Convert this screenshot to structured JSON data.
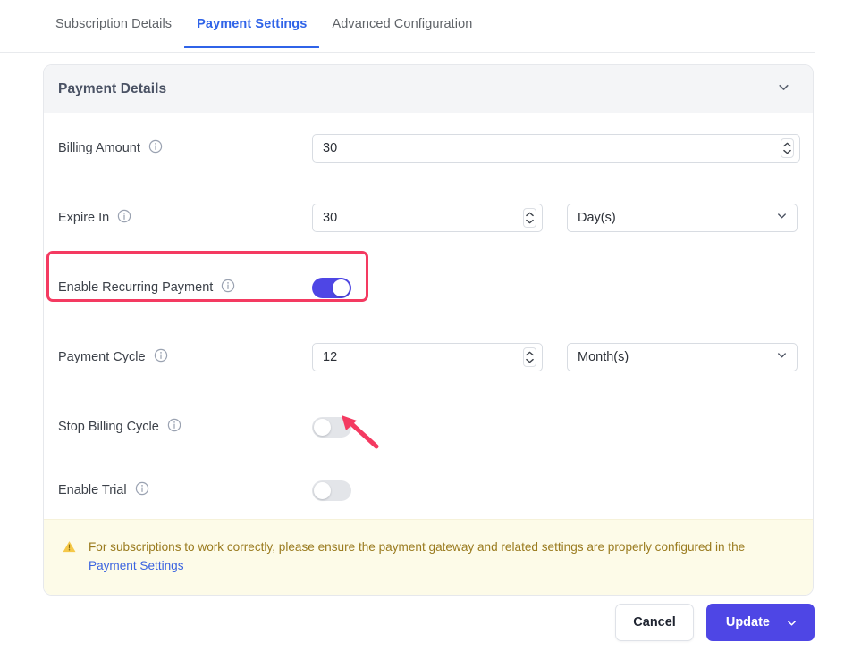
{
  "tabs": [
    {
      "label": "Subscription Details",
      "active": false
    },
    {
      "label": "Payment Settings",
      "active": true
    },
    {
      "label": "Advanced Configuration",
      "active": false
    }
  ],
  "panel": {
    "title": "Payment Details",
    "collapse_icon": "chevron-down-icon"
  },
  "fields": {
    "billing_amount": {
      "label": "Billing Amount",
      "info_icon": "info-icon",
      "value": "30"
    },
    "expire_in": {
      "label": "Expire In",
      "info_icon": "info-icon",
      "value": "30",
      "unit": "Day(s)"
    },
    "enable_recurring_payment": {
      "label": "Enable Recurring Payment",
      "info_icon": "info-icon",
      "state": "on"
    },
    "payment_cycle": {
      "label": "Payment Cycle",
      "info_icon": "info-icon",
      "value": "12",
      "unit": "Month(s)"
    },
    "stop_billing_cycle": {
      "label": "Stop Billing Cycle",
      "info_icon": "info-icon",
      "state": "off"
    },
    "enable_trial": {
      "label": "Enable Trial",
      "info_icon": "info-icon",
      "state": "off"
    }
  },
  "notice": {
    "icon": "warning-triangle-icon",
    "text": "For subscriptions to work correctly, please ensure the payment gateway and related settings are properly configured in the ",
    "link_label": "Payment Settings"
  },
  "footer": {
    "cancel_label": "Cancel",
    "update_label": "Update",
    "update_menu_icon": "chevron-down-icon"
  },
  "annotations": {
    "highlight_target": "Enable Recurring Payment",
    "arrow_target": "Stop Billing Cycle toggle"
  },
  "colors": {
    "accent_tab": "#2f63e8",
    "toggle_on": "#4e46e5",
    "primary_button": "#4e46e5",
    "annotation": "#f43a61",
    "notice_bg": "#fdfbe8",
    "notice_text": "#9a7b1f",
    "link": "#3a63e0"
  }
}
